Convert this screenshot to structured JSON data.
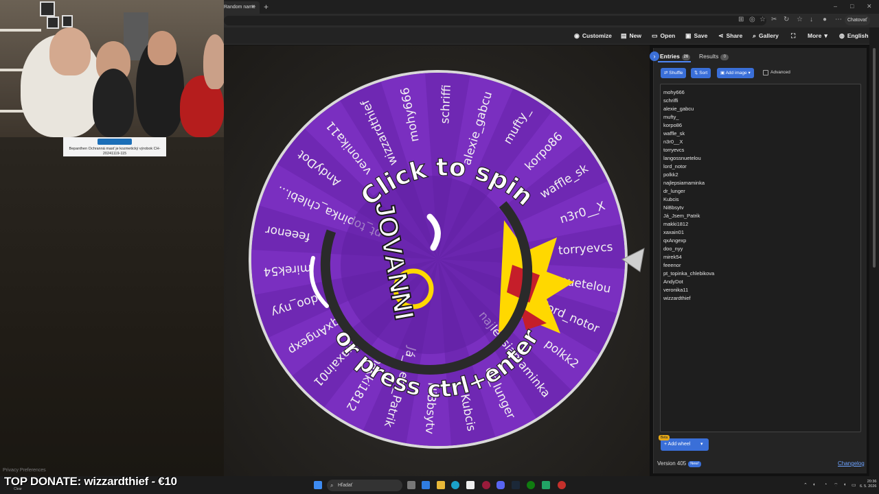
{
  "browser": {
    "tab_title": "Random name",
    "tab_close": "×",
    "new_tab": "+",
    "chat_button": "Chatovať"
  },
  "nav": {
    "customize": "Customize",
    "new": "New",
    "open": "Open",
    "save": "Save",
    "share": "Share",
    "gallery": "Gallery",
    "fullscreen_icon": "expand-icon",
    "more": "More",
    "language": "English"
  },
  "wheel": {
    "overlay_top": "Click to spin",
    "overlay_bottom": "or press ctrl+enter",
    "center_logo_text": "JOVANNI",
    "segment_color": "#7a2fc0",
    "segment_color_alt": "#6f28b3",
    "segments": [
      "mohy666",
      "schriffi",
      "alexie_gabcu",
      "mufty_",
      "korpo86",
      "waffle_sk",
      "n3r0__X",
      "torryevcs",
      "langossnuetelou",
      "lord_notor",
      "polkk2",
      "najlepsiamaminka",
      "dr_lunger",
      "Kubcis",
      "NiBbsytv",
      "Já_Jsem_Patrik",
      "makki1812",
      "xaxain01",
      "qxAngexp",
      "doo_nyy",
      "mirek54",
      "feeenor",
      "pt_topinka_chlebi...",
      "AndyDot",
      "veronika11",
      "wizzardthief"
    ]
  },
  "panel": {
    "tab_entries": "Entries",
    "entries_count": "26",
    "tab_results": "Results",
    "results_count": "0",
    "shuffle": "Shuffle",
    "sort": "Sort",
    "add_image": "Add image",
    "advanced": "Advanced",
    "entries": [
      "mohy666",
      "schriffi",
      "alexie_gabcu",
      "mufty_",
      "korpo86",
      "waffle_sk",
      "n3r0__X",
      "torryevcs",
      "langossnuetelou",
      "lord_notor",
      "polkk2",
      "najlepsiamaminka",
      "dr_lunger",
      "Kubcis",
      "NiBbsytv",
      "Já_Jsem_Patrik",
      "makki1812",
      "xaxain01",
      "qxAngexp",
      "doo_nyy",
      "mirek54",
      "feeenor",
      "pt_topinka_chlebikova",
      "AndyDot",
      "veronika11",
      "wizzardthief"
    ],
    "beta": "Beta",
    "add_wheel": "Add wheel",
    "version": "Version 405",
    "new_badge": "New!",
    "changelog": "Changelog"
  },
  "overlay": {
    "ad_text": "Bepanthen Ochranná masť je kozmetický výrobok CH-20241119-115",
    "privacy": "Privacy Preferences",
    "donate": "TOP DONATE: wizzardthief - €10",
    "weather": "Clear"
  },
  "taskbar": {
    "search_placeholder": "Hľadať",
    "time": "20:36",
    "date": "6. 5. 2026"
  }
}
